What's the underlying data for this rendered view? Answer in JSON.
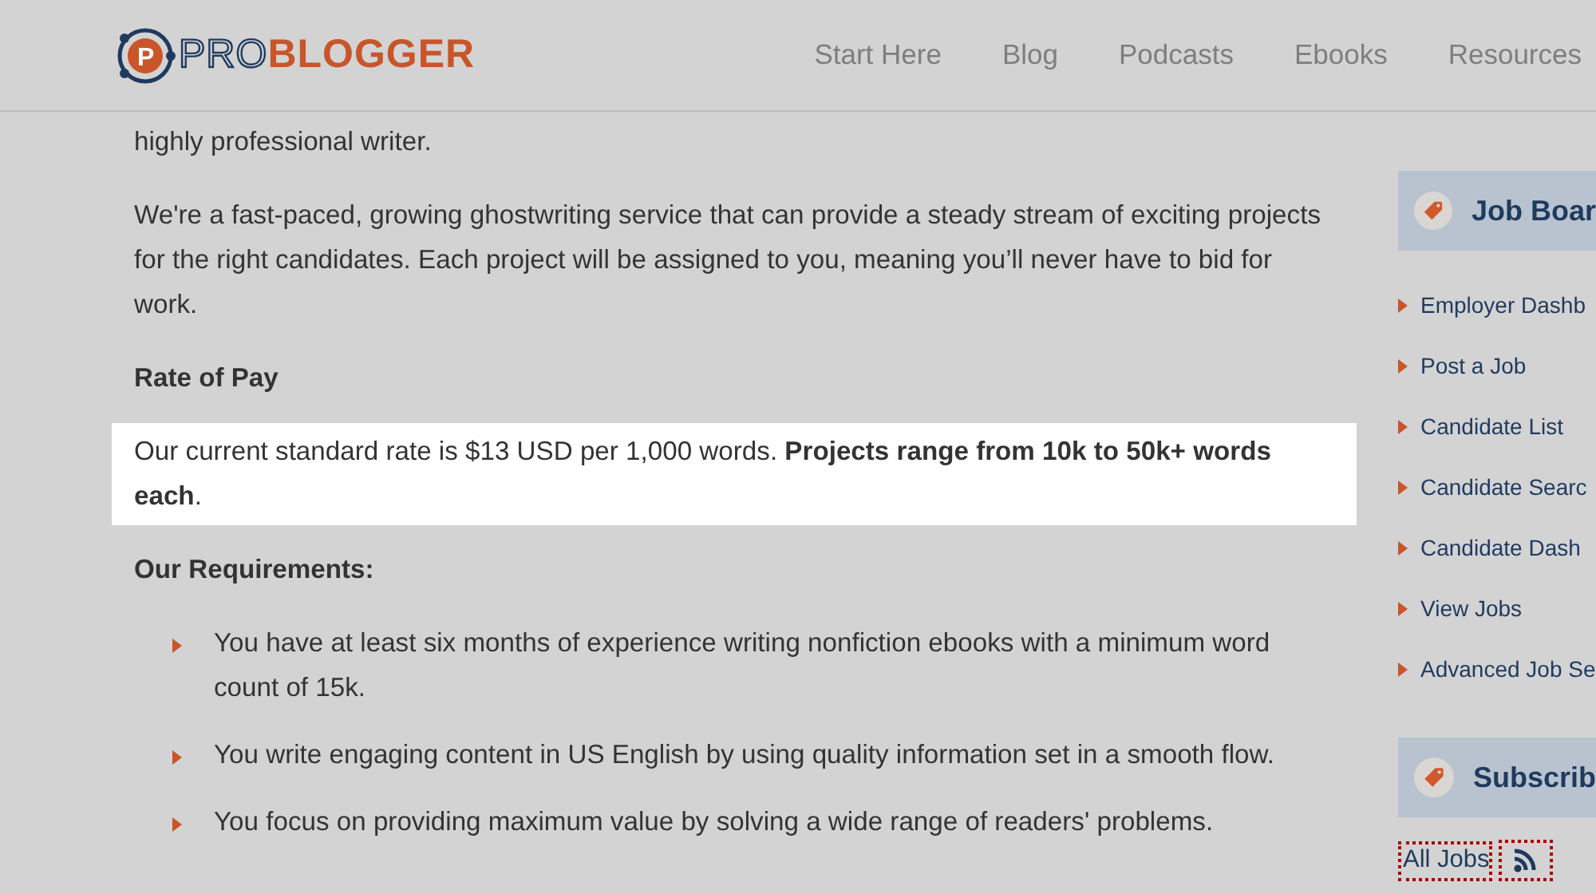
{
  "header": {
    "logo": {
      "icon_letter": "P",
      "part_1": "PRO",
      "part_2": "BLOGGER"
    },
    "nav": [
      {
        "label": "Start Here"
      },
      {
        "label": "Blog"
      },
      {
        "label": "Podcasts"
      },
      {
        "label": "Ebooks"
      },
      {
        "label": "Resources"
      }
    ]
  },
  "article": [
    {
      "kind": "text",
      "text": "highly professional writer.",
      "highlighted": false
    },
    {
      "kind": "text",
      "text": "We're a fast-paced, growing ghostwriting service that can provide a steady stream of exciting projects for the right candidates. Each project will be assigned to you, meaning you’ll never have to bid for work.",
      "highlighted": false
    },
    {
      "kind": "heading",
      "text": "Rate of Pay",
      "highlighted": false
    },
    {
      "kind": "text",
      "text": "Our current standard rate is $13 USD per 1,000 words. **Projects range from 10k to 50k+ words each**.",
      "highlighted": true
    },
    {
      "kind": "heading",
      "text": "Our Requirements:",
      "highlighted": false
    },
    {
      "kind": "list",
      "items": [
        "You have at least six months of experience writing nonfiction ebooks with a minimum word count of 15k.",
        "You write engaging content in US English by using quality information set in a smooth flow.",
        "You focus on providing maximum value by solving a wide range of readers' problems."
      ]
    }
  ],
  "sidebar": {
    "widgets": [
      {
        "title": "Job Boar",
        "links": [
          "Employer Dashb",
          "Post a Job",
          "Candidate List",
          "Candidate Searc",
          "Candidate Dash",
          "View Jobs",
          "Advanced Job Se"
        ]
      },
      {
        "title": "Subscrib"
      }
    ],
    "feed_link": "All Jobs"
  }
}
